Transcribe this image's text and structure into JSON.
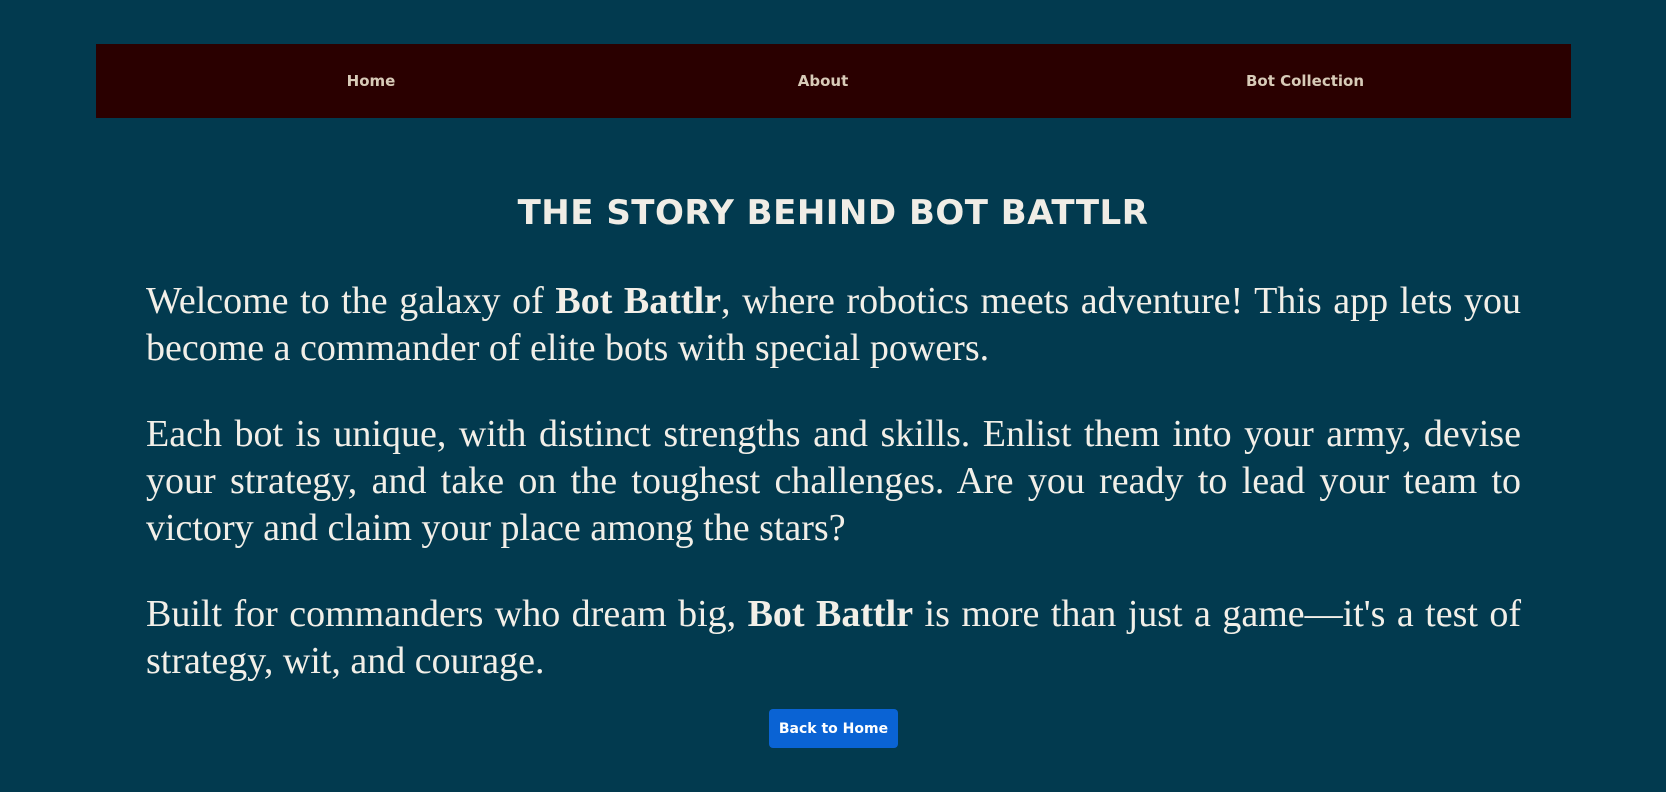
{
  "nav": {
    "items": [
      {
        "label": "Home"
      },
      {
        "label": "About"
      },
      {
        "label": "Bot Collection"
      }
    ]
  },
  "page": {
    "title": "THE STORY BEHIND BOT BATTLR"
  },
  "content": {
    "p1": {
      "before": "Welcome to the galaxy of ",
      "bold": "Bot Battlr",
      "after": ", where robotics meets adventure! This app lets you become a commander of elite bots with special powers."
    },
    "p2": {
      "text": "Each bot is unique, with distinct strengths and skills. Enlist them into your army, devise your strategy, and take on the toughest challenges. Are you ready to lead your team to victory and claim your place among the stars?"
    },
    "p3": {
      "before": "Built for commanders who dream big, ",
      "bold": "Bot Battlr",
      "after": " is more than just a game—it's a test of strategy, wit, and courage."
    }
  },
  "actions": {
    "back_label": "Back to Home"
  },
  "colors": {
    "background": "#023a4f",
    "navbar": "#2a0000",
    "nav_text": "#d8cbb8",
    "body_text": "#f2efe8",
    "button": "#0a63d4"
  }
}
